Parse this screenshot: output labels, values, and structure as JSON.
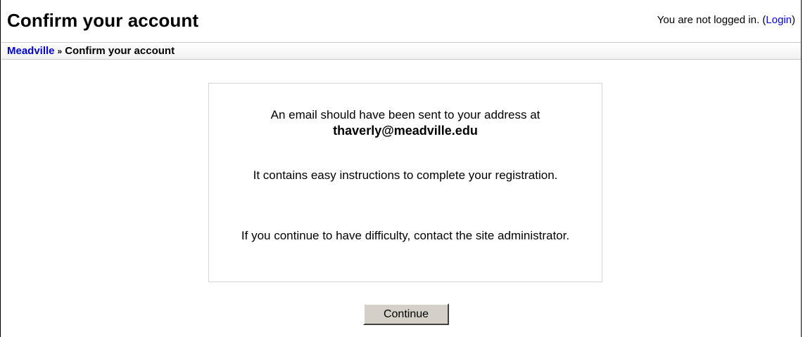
{
  "header": {
    "title": "Confirm your account",
    "login_status_prefix": "You are not logged in. (",
    "login_link": "Login",
    "login_status_suffix": ")"
  },
  "navbar": {
    "home_link": "Meadville",
    "separator": "»",
    "current": "Confirm your account"
  },
  "message": {
    "line1_prefix": "An email should have been sent to your address at",
    "email": "thaverly@meadville.edu",
    "line2": "It contains easy instructions to complete your registration.",
    "line3": "If you continue to have difficulty, contact the site administrator."
  },
  "actions": {
    "continue_label": "Continue"
  }
}
